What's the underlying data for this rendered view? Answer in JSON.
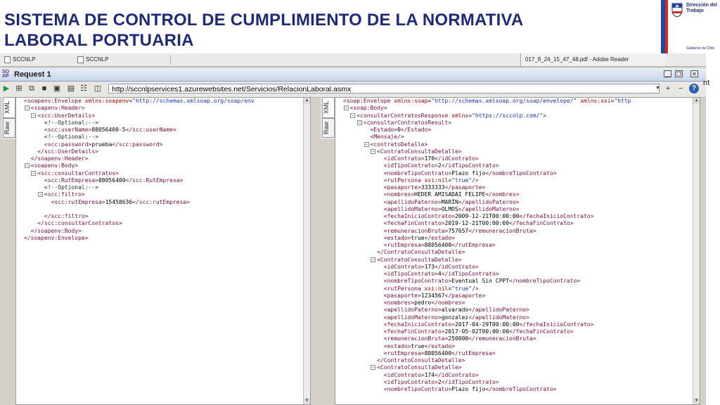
{
  "slide": {
    "title_line1": "SISTEMA DE CONTROL DE CUMPLIMIENTO DE LA NORMATIVA",
    "title_line2": "LABORAL PORTUARIA",
    "logo_line1": "Dirección del",
    "logo_line2": "Trabajo",
    "logo_footer": "Gobierno de Chile",
    "title_color": "#1f2a78"
  },
  "taskbar": {
    "tabs": [
      "SCCNLP",
      "SCCNLP"
    ],
    "adobe_title": "017_8_24_15_47_48.pdf - Adobe Reader"
  },
  "request": {
    "title": "Request 1",
    "url": "http://sccnlpservices1.azurewebsites.net/Servicios/RelacionLaboral.asmx",
    "help": "?"
  },
  "left_tabs": [
    "XML",
    "Raw"
  ],
  "right_tabs": [
    "XML",
    "Raw"
  ],
  "side_text": "nt",
  "request_xml": [
    "<soapenv:Envelope xmlns:soapenv=\"http://schemas.xmlsoap.org/soap/env",
    "   <soapenv:Header>",
    "      <scc:UserDetails>",
    "         <!--Optional:-->",
    "         <scc:userName>88056400-5</scc:userName>",
    "         <!--Optional:-->",
    "         <scc:password>prueba</scc:password>",
    "      </scc:UserDetails>",
    "   </soapenv:Header>",
    "   <soapenv:Body>",
    "      <scc:consultarContratos>",
    "         <scc:RutEmpresa>88056400</scc:RutEmpresa>",
    "         <!--Optional:-->",
    "         <scc:filtro>",
    "            <scc:rutEmpresa>15458636</scc:rutEmpresa>",
    "",
    "         </scc:filtro>",
    "      </scc:consultarContratos>",
    "   </soapenv:Body>",
    "</soapenv:Envelope>"
  ],
  "response_xml": [
    "<soap:Envelope xmlns:soap=\"http://schemas.xmlsoap.org/soap/envelope/\" xmlns:xsi=\"http",
    "   <soap:Body>",
    "      <consultarContratosResponse xmlns=\"https://sccnlp.com/\">",
    "         <consultarContratosResult>",
    "            <Estado>0</Estado>",
    "            <Mensaje/>",
    "            <contratoDetalle>",
    "               <ContratoConsultaDetalle>",
    "                  <idContrato>170</idContrato>",
    "                  <idTipoContrato>2</idTipoContrato>",
    "                  <nombreTipoContrato>Plazo fijo</nombreTipoContrato>",
    "                  <rutPersona xsi:nil=\"true\"/>",
    "                  <pasaporte>3333333</pasaporte>",
    "                  <nombres>HEDER AMISADAI FELIPE</nombres>",
    "                  <apellidoPaterno>MARÍN</apellidoPaterno>",
    "                  <apellidoMaterno>OLMOS</apellidoMaterno>",
    "                  <fechaInicioContrato>2009-12-21T00:00:00</fechaInicioContrato>",
    "                  <fechaFinContrato>2019-12-21T00:00:00</fechaFinContrato>",
    "                  <remuneracionBruta>757657</remuneracionBruta>",
    "                  <estado>true</estado>",
    "                  <rutEmpresa>88056400</rutEmpresa>",
    "               </ContratoConsultaDetalle>",
    "               <ContratoConsultaDetalle>",
    "                  <idContrato>173</idContrato>",
    "                  <idTipoContrato>4</idTipoContrato>",
    "                  <nombreTipoContrato>Eventual Sin CPPT</nombreTipoContrato>",
    "                  <rutPersona xsi:nil=\"true\"/>",
    "                  <pasaporte>1234567</pasaporte>",
    "                  <nombres>pedro</nombres>",
    "                  <apellidoPaterno>alvarado</apellidoPaterno>",
    "                  <apellidoMaterno>gonzalez</apellidoMaterno>",
    "                  <fechaInicioContrato>2017-04-29T00:00:00</fechaInicioContrato>",
    "                  <fechaFinContrato>2017-05-02T00:00:00</fechaFinContrato>",
    "                  <remuneracionBruta>250000</remuneracionBruta>",
    "                  <estado>true</estado>",
    "                  <rutEmpresa>88056400</rutEmpresa>",
    "               </ContratoConsultaDetalle>",
    "               <ContratoConsultaDetalle>",
    "                  <idContrato>174</idContrato>",
    "                  <idTipoContrato>2</idTipoContrato>",
    "                  <nombreTipoContrato>Plazo fijo</nombreTipoContrato>"
  ]
}
